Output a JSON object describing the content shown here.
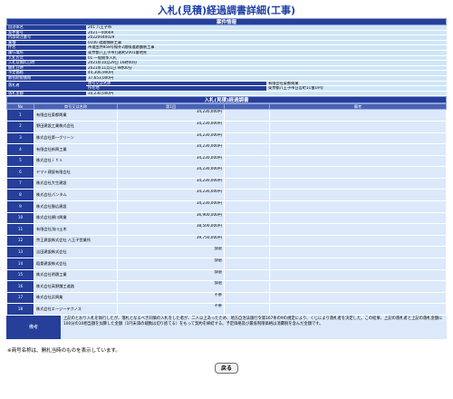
{
  "page_title": "入札(見積)経過調書詳細(工事)",
  "case_section": {
    "header": "案件情報",
    "rows": [
      {
        "label": "自治体名",
        "value": "201 八王子市"
      },
      {
        "label": "案件番号",
        "value": "2021ー00669"
      },
      {
        "label": "内部発注番号",
        "value": "20220040029"
      },
      {
        "label": "業種",
        "value": "0100 道路舗装工事"
      },
      {
        "label": "件名",
        "value": "市道由井858号線外2路線道路舗装工事"
      },
      {
        "label": "履行場所",
        "value": "東京都八王子市打越町2001番地先"
      },
      {
        "label": "入札方式",
        "value": "01 一般競争入札"
      },
      {
        "label": "入札及開札日時",
        "value": "2021年10月29日 16時00分"
      },
      {
        "label": "開札日時",
        "value": "2021年11月1日 9時00分"
      },
      {
        "label": "予定価格",
        "value": "44,306,900円"
      },
      {
        "label": "最低制限価格",
        "value": "37,653,000円"
      }
    ],
    "winner_label": "落札者",
    "winner_name_label": "商号又は名称",
    "winner_name": "有限会社東都興業",
    "winner_addr_label": "所在地",
    "winner_addr": "東京都八王子市日吉町11番19号",
    "award_amount_label": "落札金額",
    "award_amount": "34,230,000円"
  },
  "bid_section": {
    "header": "入札(見積)経過調書",
    "col_no": "No",
    "col_name": "商号又は名称",
    "col_round1": "第1回",
    "col_round2": "",
    "col_remarks": "備考",
    "rows": [
      {
        "no": "1",
        "name": "有限会社東都興業",
        "amount": "34,230,000円"
      },
      {
        "no": "2",
        "name": "野田建設工業株式会社",
        "amount": "34,230,000円"
      },
      {
        "no": "3",
        "name": "株式会社第一グリーン",
        "amount": "34,230,000円"
      },
      {
        "no": "4",
        "name": "有限会社新興工業",
        "amount": "34,230,000円"
      },
      {
        "no": "5",
        "name": "株式会社ｉｔｓ",
        "amount": "34,230,000円"
      },
      {
        "no": "6",
        "name": "ヤマト建設有限会社",
        "amount": "34,230,000円"
      },
      {
        "no": "7",
        "name": "株式会社大生建設",
        "amount": "34,230,000円"
      },
      {
        "no": "8",
        "name": "株式会社パンタム",
        "amount": "34,230,000円"
      },
      {
        "no": "9",
        "name": "株式会社勝広建設",
        "amount": "34,230,000円"
      },
      {
        "no": "10",
        "name": "株式会社横川興業",
        "amount": "36,900,000円"
      },
      {
        "no": "11",
        "name": "有限会社浅川土木",
        "amount": "38,500,000円"
      },
      {
        "no": "12",
        "name": "京王建設株式会社 八王子営業所",
        "amount": "39,750,000円"
      },
      {
        "no": "13",
        "name": "吉田建設株式会社",
        "amount": "辞退"
      },
      {
        "no": "14",
        "name": "稲桑建設株式会社",
        "amount": "辞退"
      },
      {
        "no": "15",
        "name": "株式会社明晟工業",
        "amount": "辞退"
      },
      {
        "no": "16",
        "name": "株式会社高野舗工道路",
        "amount": "辞退"
      },
      {
        "no": "17",
        "name": "株式会社浜興業",
        "amount": "不参"
      },
      {
        "no": "18",
        "name": "株式会社エージーテクノス",
        "amount": "不参"
      }
    ],
    "remarks_label": "備考",
    "remarks_text": "上記のとおり入札を執行したが、落札となるべき同価の入札をした者が、二人以上あったため、地方自治法施行令第167条の9の規定により、くじにより落札者を決定した。この結果、上記の落札者と上記の落札金額に100分の10相当額を加算した金額（1円未満の端数は切り捨てる）をもって契約を締結する。予定価格及び最低制限価格は消費税を含んだ金額です。"
  },
  "footnote": "※商号名称は、開札当時のものを表示しています。",
  "back_button": "戻る"
}
